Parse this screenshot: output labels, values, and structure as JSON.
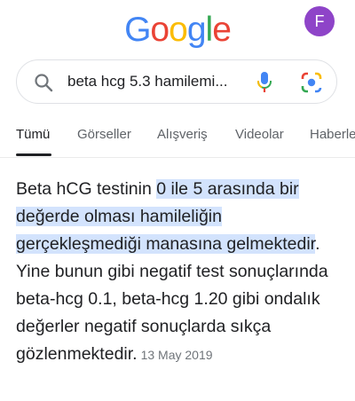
{
  "header": {
    "logo_letters": [
      {
        "char": "G",
        "color": "#4285F4"
      },
      {
        "char": "o",
        "color": "#EA4335"
      },
      {
        "char": "o",
        "color": "#FBBC05"
      },
      {
        "char": "g",
        "color": "#4285F4"
      },
      {
        "char": "l",
        "color": "#34A853"
      },
      {
        "char": "e",
        "color": "#EA4335"
      }
    ],
    "avatar_initial": "F",
    "avatar_color": "#8e44c8"
  },
  "search": {
    "query": "beta hcg 5.3 hamilemi...",
    "search_icon": "search-icon",
    "mic_icon": "mic-icon",
    "lens_icon": "google-lens-icon"
  },
  "tabs": [
    {
      "label": "Tümü",
      "active": true
    },
    {
      "label": "Görseller",
      "active": false
    },
    {
      "label": "Alışveriş",
      "active": false
    },
    {
      "label": "Videolar",
      "active": false
    },
    {
      "label": "Haberler",
      "active": false
    }
  ],
  "snippet": {
    "prefix": "Beta hCG testinin ",
    "highlight": "0 ile 5 arasında bir değerde olması hamileliğin gerçekleşmediği manasına gelmektedir",
    "suffix": ". Yine bunun gibi negatif test sonuçlarında beta-hcg 0.1, beta-hcg 1.20 gibi ondalık değerler negatif sonuçlarda sıkça gözlenmektedir.",
    "date": "13 May 2019",
    "highlight_color": "#d3e3fd"
  }
}
